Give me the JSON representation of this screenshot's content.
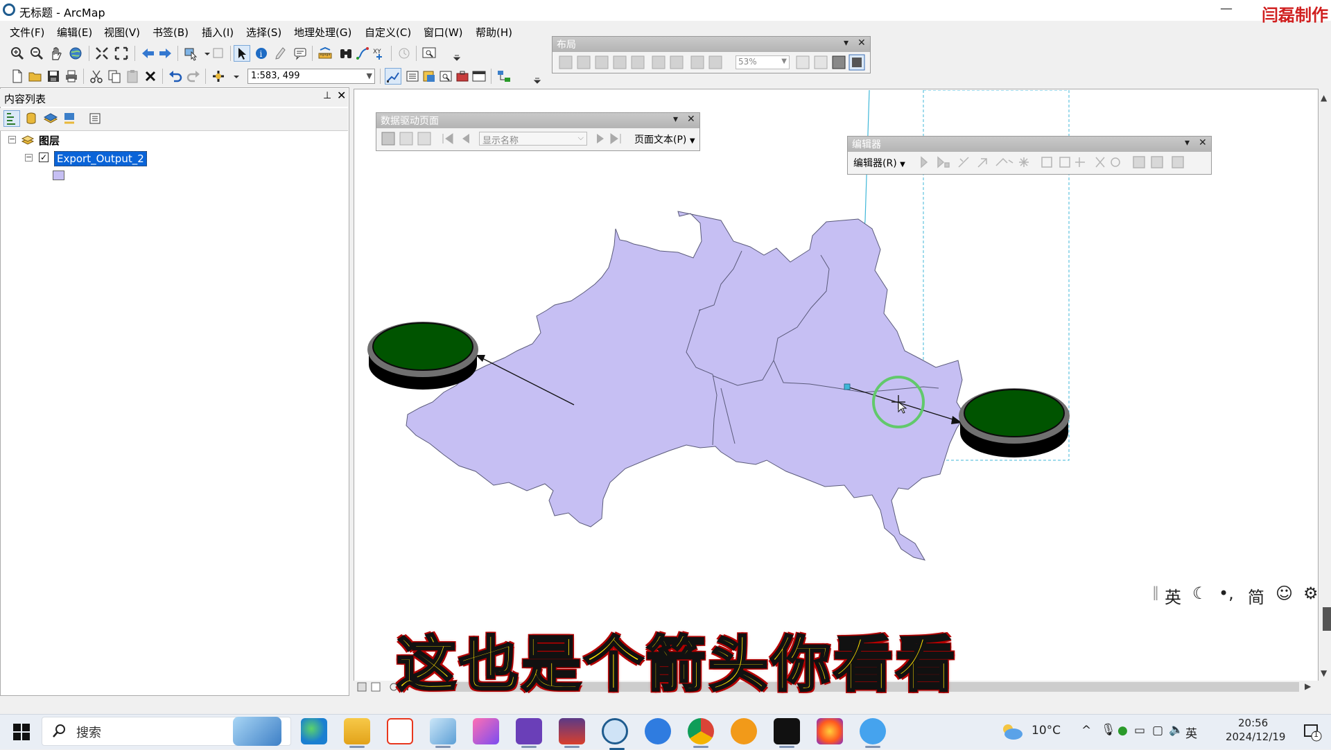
{
  "window": {
    "title": "无标题 - ArcMap",
    "minimize": "—",
    "watermark": "闫磊制作"
  },
  "menu": [
    "文件(F)",
    "编辑(E)",
    "视图(V)",
    "书签(B)",
    "插入(I)",
    "选择(S)",
    "地理处理(G)",
    "自定义(C)",
    "窗口(W)",
    "帮助(H)"
  ],
  "toolbar": {
    "scale": "1:583, 499"
  },
  "layout_toolbar": {
    "title": "布局",
    "zoom": "53%"
  },
  "data_driven_toolbar": {
    "title": "数据驱动页面",
    "name_field": "显示名称",
    "page_text": "页面文本(P)"
  },
  "editor_toolbar": {
    "title": "编辑器",
    "menu": "编辑器(R)"
  },
  "toc": {
    "title": "内容列表",
    "root": "图层",
    "layer": "Export_Output_2",
    "layer_checked": true
  },
  "subtitle": "这也是个箭头你看看",
  "ime": {
    "lang": "英",
    "mode": "简"
  },
  "taskbar": {
    "search_placeholder": "搜索",
    "weather": "10°C",
    "tray_lang": "英",
    "time": "20:56",
    "date": "2024/12/19",
    "notification_count": "1"
  },
  "colors": {
    "polygon_fill": "#c6bff3",
    "marker_fill": "#005400",
    "selection_highlight": "#0a64d8",
    "subtitle_yellow": "#ffe100",
    "watermark_red": "#d02020"
  }
}
